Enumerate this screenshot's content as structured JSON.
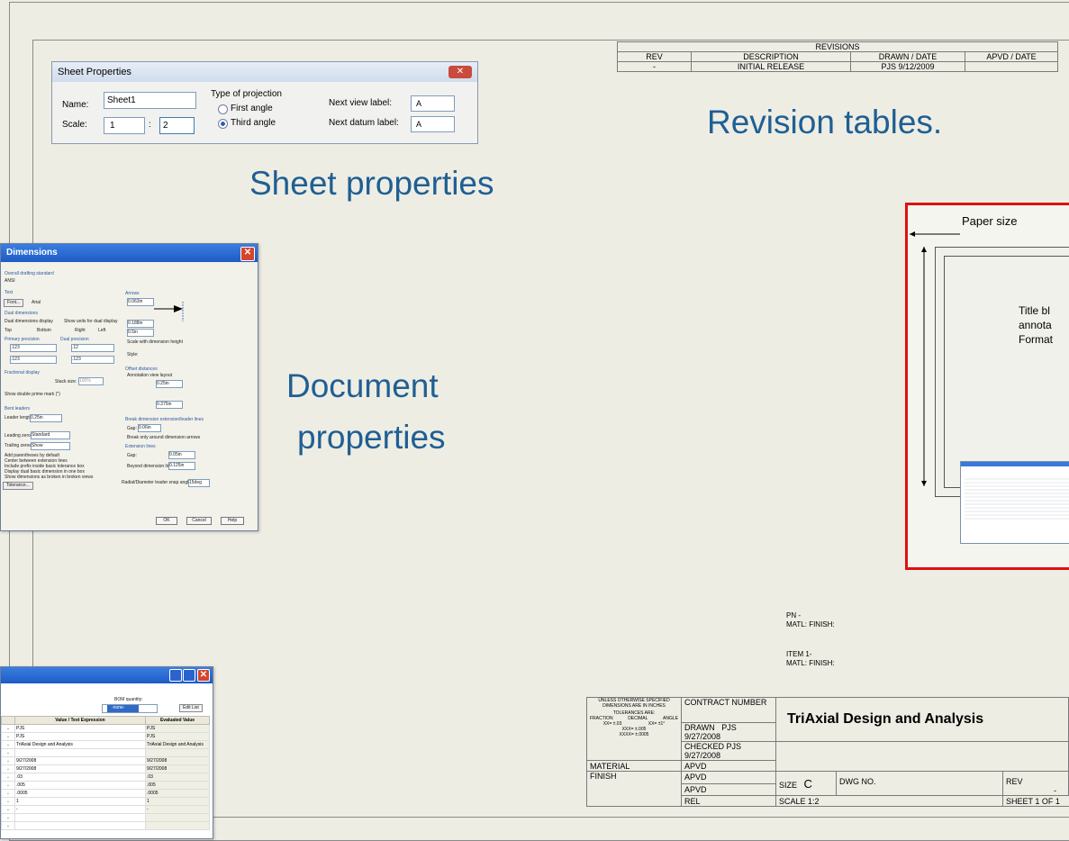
{
  "sheet_properties": {
    "title": "Sheet Properties",
    "name_label": "Name:",
    "name_value": "Sheet1",
    "scale_label": "Scale:",
    "scale_left": "1",
    "scale_colon": ":",
    "scale_right": "2",
    "projection_heading": "Type of projection",
    "projection_first": "First angle",
    "projection_third": "Third angle",
    "next_view_label": "Next view label:",
    "next_view_value": "A",
    "next_datum_label": "Next datum label:",
    "next_datum_value": "A"
  },
  "revisions": {
    "title": "REVISIONS",
    "headers": [
      "REV",
      "DESCRIPTION",
      "DRAWN / DATE",
      "APVD / DATE"
    ],
    "row": [
      "-",
      "INITIAL RELEASE",
      "PJS 9/12/2009",
      ""
    ]
  },
  "callouts": {
    "revision_tables": "Revision tables.",
    "sheet_properties": "Sheet properties",
    "document_properties_1": "Document",
    "document_properties_2": "properties"
  },
  "paper_diagram": {
    "paper_size": "Paper size",
    "line1": "Title bl",
    "line2": "annota",
    "line3": "Format"
  },
  "document_dialog": {
    "title": "Dimensions",
    "ok": "OK",
    "cancel": "Cancel",
    "help": "Help",
    "sections": [
      "Overall drafting standard",
      "Text",
      "Dual dimensions",
      "Primary precision",
      "Dual precision",
      "Fractional display",
      "Bent leaders",
      "Arrows",
      "Offset distances",
      "Break dimension extension/leader lines",
      "Extension lines"
    ],
    "standard_value": "ANSI",
    "font_button": "Font...",
    "font_name": "Arial",
    "opt_dual_display": "Dual dimensions display",
    "opt_show_units": "Show units for dual display",
    "opt_top": "Top",
    "opt_bottom": "Bottom",
    "opt_right": "Right",
    "opt_left": "Left",
    "prec_a": ".123",
    "prec_b": ".12",
    "leader_label": "Leader length:",
    "leader_value": "0.25in",
    "leading_label": "Leading zeroes:",
    "leading_value": "Standard",
    "trailing_label": "Trailing zeroes:",
    "trailing_value": "Show",
    "cb1": "Add parentheses by default",
    "cb2": "Center between extension lines",
    "cb3": "Include prefix inside basic tolerance box",
    "cb4": "Display dual basic dimension in one box",
    "cb5": "Show dimensions as broken in broken views",
    "tolerance_button": "Tolerance...",
    "arrow1": "0.063in",
    "arrow2": "0.188in",
    "arrow3": "0.5in",
    "scale_cb": "Scale with dimension height",
    "style_label": "Style:",
    "offset_cb": "Annotation view layout",
    "offset1": "0.25in",
    "offset2": "0.375in",
    "gap_label": "Gap:",
    "gap_value": "0.06in",
    "break_cb": "Break only around dimension arrows",
    "ext_gap_label": "Gap:",
    "ext_gap_value": "0.05in",
    "beyond_label": "Beyond dimension line:",
    "beyond_value": "0.125in",
    "radial_label": "Radial/Diameter leader snap angle:",
    "radial_value": "15deg",
    "stack_label": "Stack size:",
    "stack_value": "100%",
    "double_prime": "Show double prime mark (\")"
  },
  "bom_dialog": {
    "bom_label": "BOM quantity:",
    "bom_value": "-none-",
    "edit_list": "Edit List",
    "col_value": "Value / Text Expression",
    "col_eval": "Evaluated Value",
    "rows": [
      [
        "PJS",
        "PJS"
      ],
      [
        "PJS",
        "PJS"
      ],
      [
        "TriAxial Design and Analysis",
        "TriAxial Design and Analysis"
      ],
      [
        "",
        ""
      ],
      [
        "9/27/2008",
        "9/27/2008"
      ],
      [
        "9/27/2008",
        "9/27/2008"
      ],
      [
        ".03",
        ".03"
      ],
      [
        ".005",
        ".005"
      ],
      [
        ".0005",
        ".0005"
      ],
      [
        "1",
        "1"
      ],
      [
        "-",
        "-"
      ],
      [
        "",
        ""
      ],
      [
        "",
        ""
      ]
    ]
  },
  "notes": {
    "pn": "PN -",
    "matl_finish": "MATL:  FINISH:",
    "item": "ITEM 1-",
    "matl_finish2": "MATL:  FINISH:"
  },
  "title_block": {
    "unless": "UNLESS OTHERWISE SPECIFIED",
    "dims": "DIMENSIONS ARE IN INCHES",
    "tolerances": "TOLERANCES ARE:",
    "fraction": "FRACTION",
    "decimal": "DECIMAL",
    "angle": "ANGLE",
    "tol1": "XX= ±.03",
    "tol2": "XXX= ±.005",
    "tol3": "XXXX= ±.0005",
    "tol_angle": "XX= ±1°",
    "contract": "CONTRACT NUMBER",
    "company": "TriAxial Design and Analysis",
    "drawn": "DRAWN",
    "drawn_val": "PJS 9/27/2008",
    "checked": "CHECKED",
    "checked_val": "PJS 9/27/2008",
    "material": "MATERIAL",
    "apvd1": "APVD",
    "apvd2": "APVD",
    "apvd3": "APVD",
    "finish": "FINISH",
    "rel": "REL",
    "size_label": "SIZE",
    "size_value": "C",
    "dwg_no": "DWG NO.",
    "rev_label": "REV",
    "rev_value": "-",
    "scale": "SCALE  1:2",
    "sheet": "SHEET 1 OF 1"
  }
}
